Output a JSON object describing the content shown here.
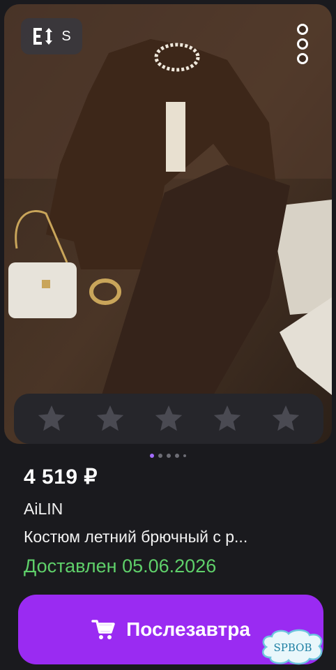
{
  "product": {
    "size_badge": "S",
    "price": "4 519 ₽",
    "brand": "AiLIN",
    "title": "Костюм летний брючный с р...",
    "delivery": "Доставлен 05.06.2026",
    "rating_stars": 5,
    "rating_filled": 0,
    "gallery_pages": 5,
    "gallery_active": 1
  },
  "action": {
    "button_label": "Послезавтра",
    "icon": "cart-icon"
  },
  "watermark": {
    "text": "SPBOB"
  },
  "colors": {
    "background": "#1a1a1e",
    "accent": "#9a2bf2",
    "delivery_green": "#5fd06a",
    "pager_active": "#a36cff"
  }
}
